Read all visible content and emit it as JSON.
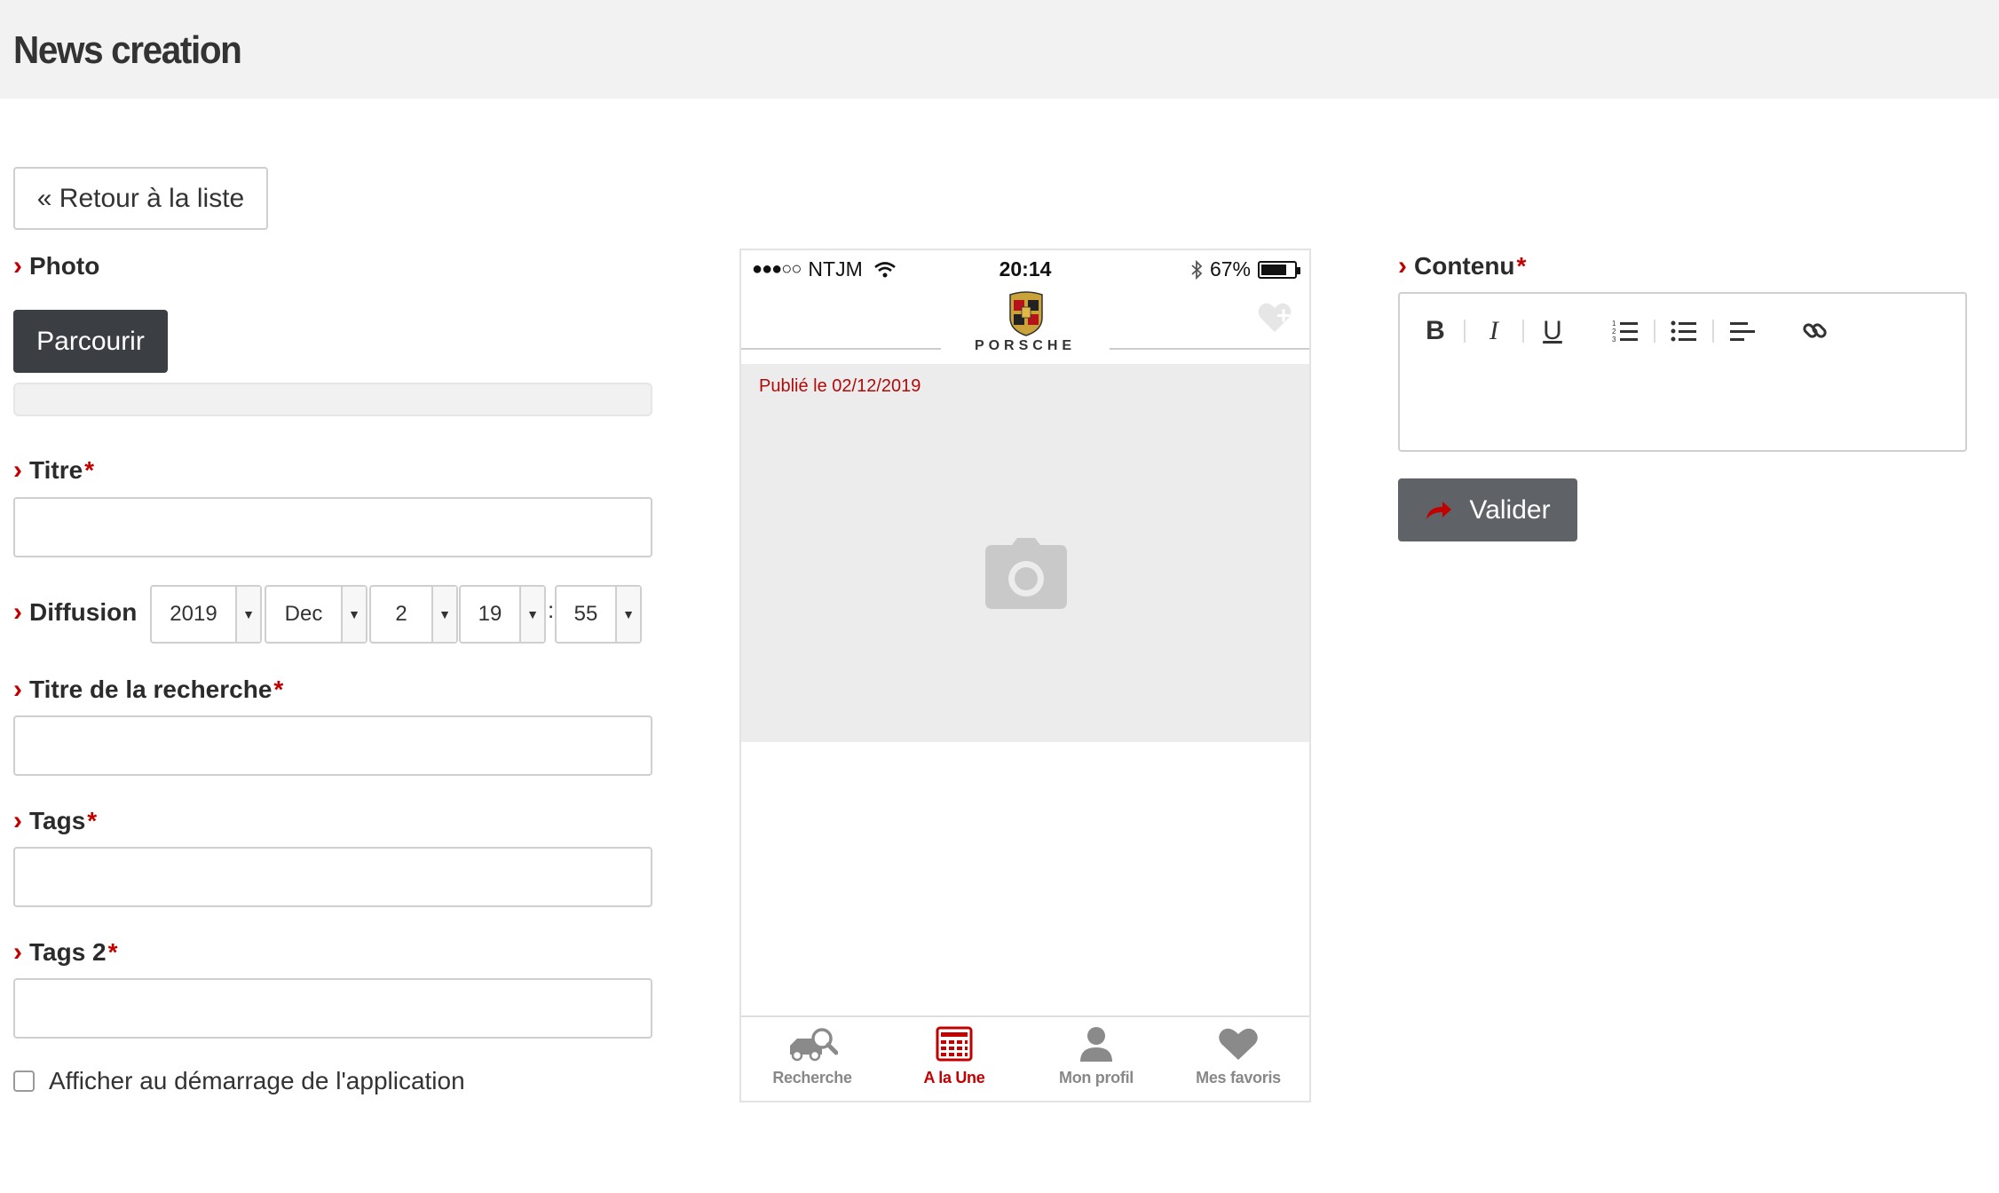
{
  "header": {
    "title": "News creation"
  },
  "back_button": {
    "label": "« Retour à la liste"
  },
  "form": {
    "photo": {
      "label": "Photo",
      "browse_label": "Parcourir"
    },
    "titre": {
      "label": "Titre",
      "required_mark": "*",
      "value": ""
    },
    "diffusion": {
      "label": "Diffusion",
      "year": "2019",
      "month": "Dec",
      "day": "2",
      "hour": "19",
      "minute": "55",
      "separator": ":"
    },
    "titre_recherche": {
      "label": "Titre de la recherche",
      "required_mark": "*",
      "value": ""
    },
    "tags": {
      "label": "Tags",
      "required_mark": "*",
      "value": ""
    },
    "tags2": {
      "label": "Tags 2",
      "required_mark": "*",
      "value": ""
    },
    "startup_checkbox": {
      "label": "Afficher au démarrage de l'application",
      "checked": false
    }
  },
  "phone": {
    "status": {
      "carrier": "NTJM",
      "time": "20:14",
      "battery": "67%"
    },
    "brand": {
      "wordmark": "PORSCHE"
    },
    "news": {
      "published": "Publié le 02/12/2019"
    },
    "tabs": [
      {
        "label": "Recherche",
        "icon": "car-search-icon",
        "active": false
      },
      {
        "label": "A la Une",
        "icon": "newspaper-icon",
        "active": true
      },
      {
        "label": "Mon profil",
        "icon": "user-icon",
        "active": false
      },
      {
        "label": "Mes favoris",
        "icon": "heart-icon",
        "active": false
      }
    ],
    "accent": "#c30000"
  },
  "content": {
    "label": "Contenu",
    "required_mark": "*",
    "toolbar": {
      "bold": "B",
      "italic": "I",
      "underline": "U"
    }
  },
  "submit": {
    "label": "Valider"
  },
  "colors": {
    "accent": "#c30000",
    "dark_button": "#3b3f44",
    "submit_button": "#5f6266"
  }
}
